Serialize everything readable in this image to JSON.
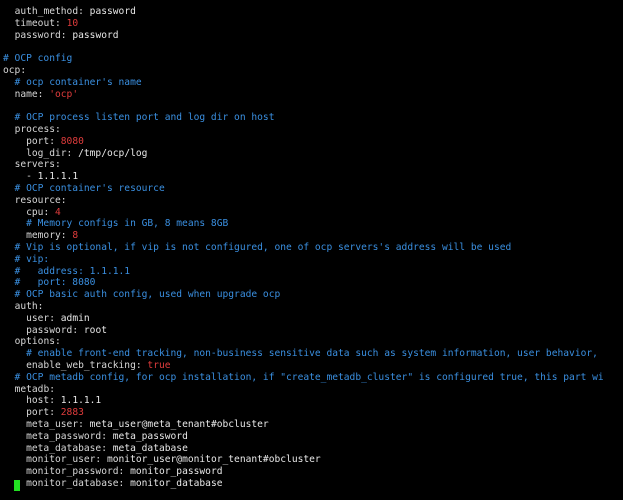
{
  "colors": {
    "background": "#000000",
    "key": "#d7d7d7",
    "comment": "#3a8fe0",
    "value": "#e8e8e8",
    "number": "#e03c3c",
    "quoted": "#e03c3c",
    "cursor": "#22e022"
  },
  "lines": [
    {
      "indent": "  ",
      "key": "auth_method",
      "value": "password",
      "vtype": "v"
    },
    {
      "indent": "  ",
      "key": "timeout",
      "value": "10",
      "vtype": "n"
    },
    {
      "indent": "  ",
      "key": "password",
      "value": "password",
      "vtype": "v"
    },
    {
      "blank": true
    },
    {
      "comment": "# OCP config"
    },
    {
      "indent": "",
      "key": "ocp",
      "value": "",
      "vtype": "v"
    },
    {
      "comment": "  # ocp container's name"
    },
    {
      "indent": "  ",
      "key": "name",
      "value": "'ocp'",
      "vtype": "s"
    },
    {
      "blank": true
    },
    {
      "comment": "  # OCP process listen port and log dir on host"
    },
    {
      "indent": "  ",
      "key": "process",
      "value": "",
      "vtype": "v"
    },
    {
      "indent": "    ",
      "key": "port",
      "value": "8080",
      "vtype": "n"
    },
    {
      "indent": "    ",
      "key": "log_dir",
      "value": "/tmp/ocp/log",
      "vtype": "v"
    },
    {
      "indent": "  ",
      "key": "servers",
      "value": "",
      "vtype": "v"
    },
    {
      "indent": "    ",
      "dash": "- ",
      "key": "",
      "value": "1.1.1.1",
      "vtype": "v"
    },
    {
      "comment": "  # OCP container's resource"
    },
    {
      "indent": "  ",
      "key": "resource",
      "value": "",
      "vtype": "v"
    },
    {
      "indent": "    ",
      "key": "cpu",
      "value": "4",
      "vtype": "n"
    },
    {
      "comment": "    # Memory configs in GB, 8 means 8GB"
    },
    {
      "indent": "    ",
      "key": "memory",
      "value": "8",
      "vtype": "n"
    },
    {
      "comment": "  # Vip is optional, if vip is not configured, one of ocp servers's address will be used"
    },
    {
      "comment": "  # vip:"
    },
    {
      "comment": "  #   address: 1.1.1.1"
    },
    {
      "comment": "  #   port: 8080"
    },
    {
      "comment": "  # OCP basic auth config, used when upgrade ocp"
    },
    {
      "indent": "  ",
      "key": "auth",
      "value": "",
      "vtype": "v"
    },
    {
      "indent": "    ",
      "key": "user",
      "value": "admin",
      "vtype": "v"
    },
    {
      "indent": "    ",
      "key": "password",
      "value": "root",
      "vtype": "v"
    },
    {
      "indent": "  ",
      "key": "options",
      "value": "",
      "vtype": "v"
    },
    {
      "comment": "    # enable front-end tracking, non-business sensitive data such as system information, user behavior, "
    },
    {
      "indent": "    ",
      "key": "enable_web_tracking",
      "value": "true",
      "vtype": "d"
    },
    {
      "comment": "  # OCP metadb config, for ocp installation, if \"create_metadb_cluster\" is configured true, this part wi"
    },
    {
      "indent": "  ",
      "key": "metadb",
      "value": "",
      "vtype": "v"
    },
    {
      "indent": "    ",
      "key": "host",
      "value": "1.1.1.1",
      "vtype": "v"
    },
    {
      "indent": "    ",
      "key": "port",
      "value": "2883",
      "vtype": "n"
    },
    {
      "indent": "    ",
      "key": "meta_user",
      "value": "meta_user@meta_tenant#obcluster",
      "vtype": "v"
    },
    {
      "indent": "    ",
      "key": "meta_password",
      "value": "meta_password",
      "vtype": "v"
    },
    {
      "indent": "    ",
      "key": "meta_database",
      "value": "meta_database",
      "vtype": "v"
    },
    {
      "indent": "    ",
      "key": "monitor_user",
      "value": "monitor_user@monitor_tenant#obcluster",
      "vtype": "v"
    },
    {
      "indent": "    ",
      "key": "monitor_password",
      "value": "monitor_password",
      "vtype": "v"
    },
    {
      "indent": "    ",
      "key": "monitor_database",
      "value": "monitor_database",
      "vtype": "v"
    }
  ]
}
